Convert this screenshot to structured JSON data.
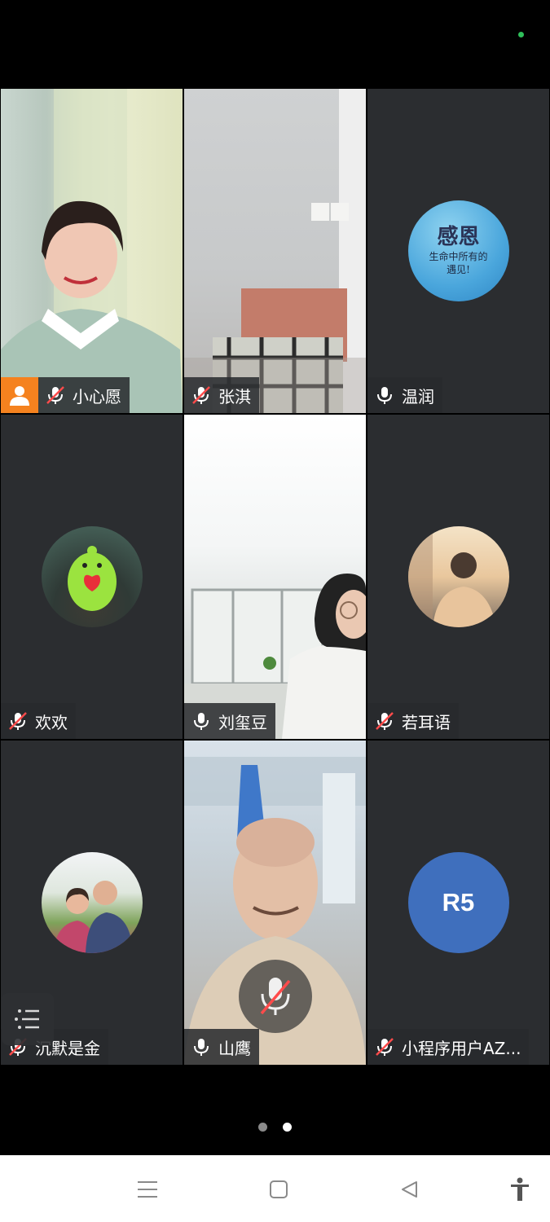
{
  "colors": {
    "background": "#000000",
    "tile": "#2b2d30",
    "active_border": "#2aa84a",
    "host_badge": "#f5821f",
    "status_dot": "#2fbf5a",
    "muted_icon": "#ff4b4b",
    "avatar_r5": "#3f6fbd"
  },
  "participants": [
    {
      "name": "小心愿",
      "mic": "muted",
      "host": true,
      "video": "on",
      "scene": "woman-in-green-sweater"
    },
    {
      "name": "张淇",
      "mic": "muted",
      "video": "on",
      "scene": "room-with-chair"
    },
    {
      "name": "温润",
      "mic": "on",
      "video": "off",
      "avatar_text": {
        "title": "感恩",
        "line1": "生命中所有的",
        "line2": "遇见!"
      }
    },
    {
      "name": "欢欢",
      "mic": "muted",
      "video": "off",
      "avatar": "green-toy-with-heart"
    },
    {
      "name": "刘玺豆",
      "mic": "on",
      "video": "on",
      "active_speaker": true,
      "scene": "woman-with-glasses-by-window"
    },
    {
      "name": "若耳语",
      "mic": "muted",
      "video": "off",
      "avatar": "woman-at-sunset"
    },
    {
      "name": "沉默是金",
      "mic": "muted",
      "video": "off",
      "avatar": "couple-photo"
    },
    {
      "name": "山鹰",
      "mic": "on",
      "video": "on",
      "scene": "man-bald"
    },
    {
      "name": "小程序用户AZ...",
      "mic": "muted",
      "video": "off",
      "avatar_initials": "R5"
    }
  ],
  "controls": {
    "participant_list_icon": "list-icon",
    "floating_mic_icon": "mic-muted-icon"
  },
  "pager": {
    "pages": 2,
    "current": 2
  },
  "nav": [
    "menu-icon",
    "home-square-icon",
    "back-triangle-icon",
    "accessibility-icon"
  ]
}
